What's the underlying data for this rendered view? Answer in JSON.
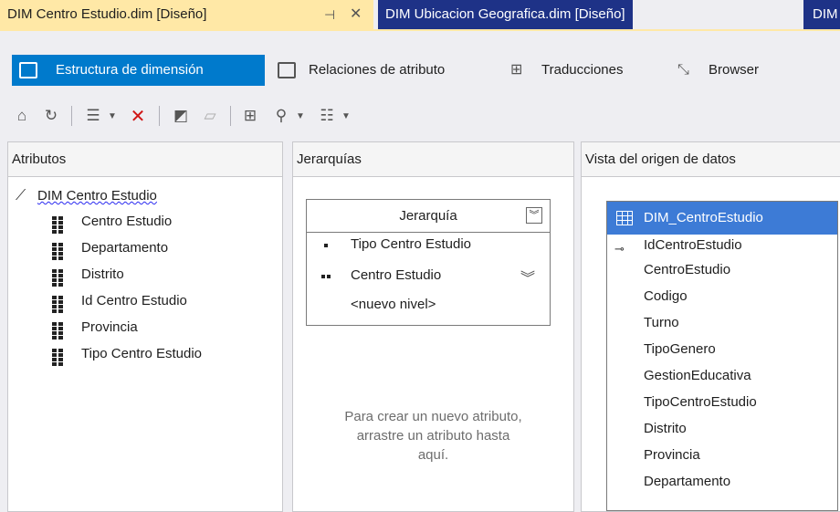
{
  "tabs": {
    "active": "DIM Centro Estudio.dim [Diseño]",
    "pin_glyph": "⊣",
    "close_glyph": "✕",
    "second": "DIM Ubicacion Geografica.dim [Diseño]",
    "third": "DIM"
  },
  "designer_tabs": {
    "structure": "Estructura de dimensión",
    "relations": "Relaciones de atributo",
    "translations": "Traducciones",
    "browser": "Browser"
  },
  "toolbar": {
    "icons": [
      "process-icon",
      "refresh-icon",
      "view-list-icon",
      "delete-icon",
      "rename-icon",
      "properties-icon",
      "show-table-icon",
      "zoom-icon",
      "layout-icon"
    ]
  },
  "attributes": {
    "header": "Atributos",
    "root": "DIM Centro Estudio",
    "items": [
      "Centro Estudio",
      "Departamento",
      "Distrito",
      "Id Centro Estudio",
      "Provincia",
      "Tipo Centro Estudio"
    ]
  },
  "hierarchies": {
    "header": "Jerarquías",
    "title": "Jerarquía",
    "levels": [
      "Tipo Centro Estudio",
      "Centro Estudio"
    ],
    "new_level": "<nuevo nivel>",
    "hint": "Para crear un nuevo atributo,\narrastre un atributo hasta\naquí."
  },
  "dsv": {
    "header": "Vista del origen de datos",
    "table_name": "DIM_CentroEstudio",
    "columns": [
      "IdCentroEstudio",
      "CentroEstudio",
      "Codigo",
      "Turno",
      "TipoGenero",
      "GestionEducativa",
      "TipoCentroEstudio",
      "Distrito",
      "Provincia",
      "Departamento"
    ]
  },
  "colors": {
    "active_tab": "#ffe8a6",
    "inactive_tab": "#1e3287",
    "accent": "#007acc",
    "table_header": "#3d7bd6"
  }
}
